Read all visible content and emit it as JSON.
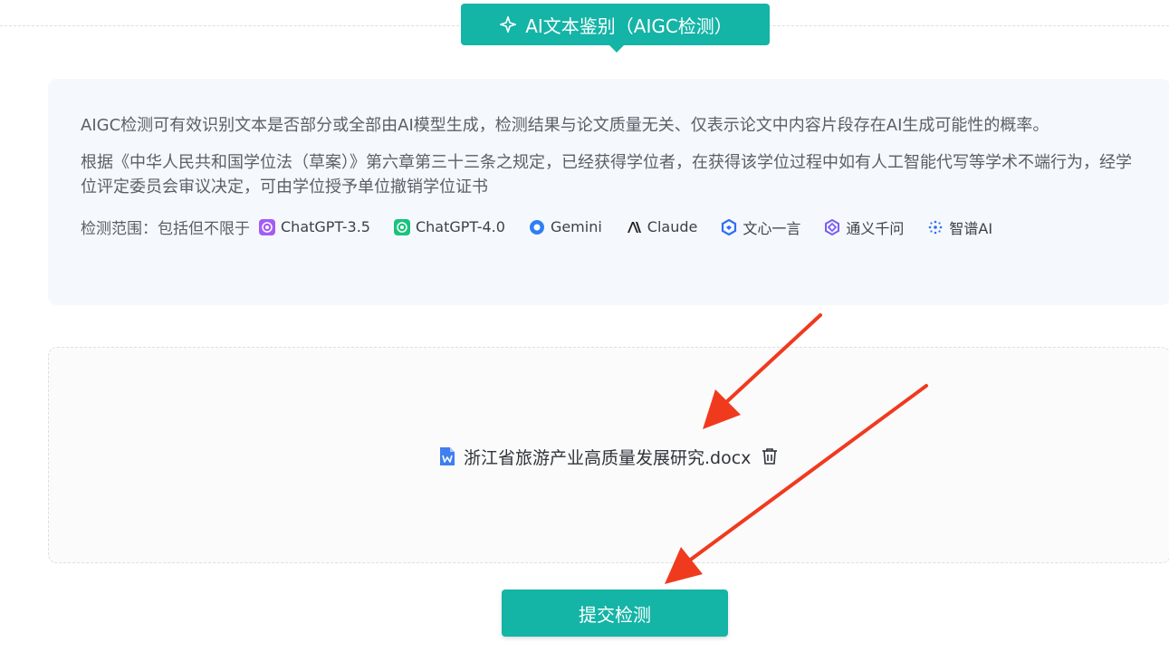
{
  "tab": {
    "title": "AI文本鉴别（AIGC检测）",
    "icon": "sparkle-icon"
  },
  "info": {
    "paragraph1": "AIGC检测可有效识别文本是否部分或全部由AI模型生成，检测结果与论文质量无关、仅表示论文中内容片段存在AI生成可能性的概率。",
    "paragraph2": "根据《中华人民共和国学位法（草案）》第六章第三十三条之规定，已经获得学位者，在获得该学位过程中如有人工智能代写等学术不端行为，经学位评定委员会审议决定，可由学位授予单位撤销学位证书",
    "scope_label": "检测范围：包括但不限于",
    "models": [
      {
        "name": "ChatGPT-3.5",
        "icon": "chatgpt-icon",
        "color": "#a35cf6"
      },
      {
        "name": "ChatGPT-4.0",
        "icon": "chatgpt-icon",
        "color": "#19c37d"
      },
      {
        "name": "Gemini",
        "icon": "gemini-icon",
        "color": "#2f7ff2"
      },
      {
        "name": "Claude",
        "icon": "claude-icon",
        "color": "#1f1f1f"
      },
      {
        "name": "文心一言",
        "icon": "wenxin-icon",
        "color": "#2f6ef2"
      },
      {
        "name": "通义千问",
        "icon": "tongyi-icon",
        "color": "#7b5cf5"
      },
      {
        "name": "智谱AI",
        "icon": "zhipu-icon",
        "color": "#2f6ef2"
      }
    ]
  },
  "upload": {
    "file_name": "浙江省旅游产业高质量发展研究.docx",
    "file_icon": "word-file-icon",
    "delete_icon": "trash-icon"
  },
  "submit": {
    "label": "提交检测"
  },
  "colors": {
    "accent": "#14b4a6",
    "annotation": "#f03a1e"
  }
}
